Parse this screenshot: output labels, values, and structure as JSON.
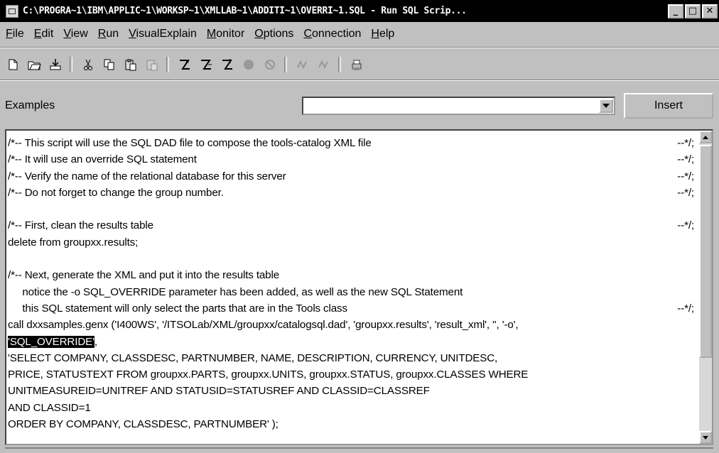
{
  "window": {
    "title": "C:\\PROGRA~1\\IBM\\APPLIC~1\\WORKSP~1\\XMLLAB~1\\ADDITI~1\\OVERRI~1.SQL - Run SQL Scrip...",
    "minimize": "_",
    "maximize": "□",
    "close": "✕"
  },
  "menu": [
    "File",
    "Edit",
    "View",
    "Run",
    "VisualExplain",
    "Monitor",
    "Options",
    "Connection",
    "Help"
  ],
  "toolbar": {
    "icons": [
      "new-icon",
      "open-icon",
      "save-icon",
      "cut-icon",
      "copy-icon",
      "paste-icon",
      "paste-disabled-icon",
      "run-icon",
      "run-selected-icon",
      "run-step-icon",
      "stop-icon",
      "cancel-icon",
      "explain-icon",
      "explain-selected-icon",
      "print-icon"
    ]
  },
  "examples": {
    "label": "Examples",
    "selected": "",
    "insert_label": "Insert"
  },
  "editor": {
    "lines": [
      {
        "text": "/*-- This script will use the SQL DAD file to compose the tools-catalog XML file",
        "end": "--*/;"
      },
      {
        "text": "/*-- It will use an override SQL statement",
        "end": "--*/;"
      },
      {
        "text": "/*-- Verify the name of the relational database for this server",
        "end": "--*/;"
      },
      {
        "text": "/*-- Do not forget to change the group number.",
        "end": "--*/;"
      },
      {
        "text": "",
        "end": ""
      },
      {
        "text": "/*-- First, clean the results table",
        "end": "--*/;"
      },
      {
        "text": "delete from groupxx.results;",
        "end": ""
      },
      {
        "text": "",
        "end": ""
      },
      {
        "text": "/*-- Next, generate the XML and put it into the results table",
        "end": ""
      },
      {
        "text": "     notice the -o SQL_OVERRIDE parameter has been added, as well as the new SQL Statement",
        "end": ""
      },
      {
        "text": "     this SQL statement will only select the parts that are in the Tools class",
        "end": "--*/;"
      },
      {
        "text": "call dxxsamples.genx ('I400WS', '/ITSOLab/XML/groupxx/catalogsql.dad', 'groupxx.results', 'result_xml', '', '-o',",
        "end": ""
      },
      {
        "text": "",
        "end": ""
      },
      {
        "text": "'SELECT COMPANY, CLASSDESC, PARTNUMBER, NAME, DESCRIPTION, CURRENCY, UNITDESC,",
        "end": ""
      },
      {
        "text": "PRICE, STATUSTEXT FROM groupxx.PARTS, groupxx.UNITS, groupxx.STATUS, groupxx.CLASSES WHERE",
        "end": ""
      },
      {
        "text": "UNITMEASUREID=UNITREF AND STATUSID=STATUSREF AND CLASSID=CLASSREF",
        "end": ""
      },
      {
        "text": "AND CLASSID=1",
        "end": ""
      },
      {
        "text": "ORDER BY COMPANY, CLASSDESC, PARTNUMBER' );",
        "end": ""
      }
    ],
    "selected_text": "'SQL_OVERRIDE'",
    "after_selection": ","
  }
}
